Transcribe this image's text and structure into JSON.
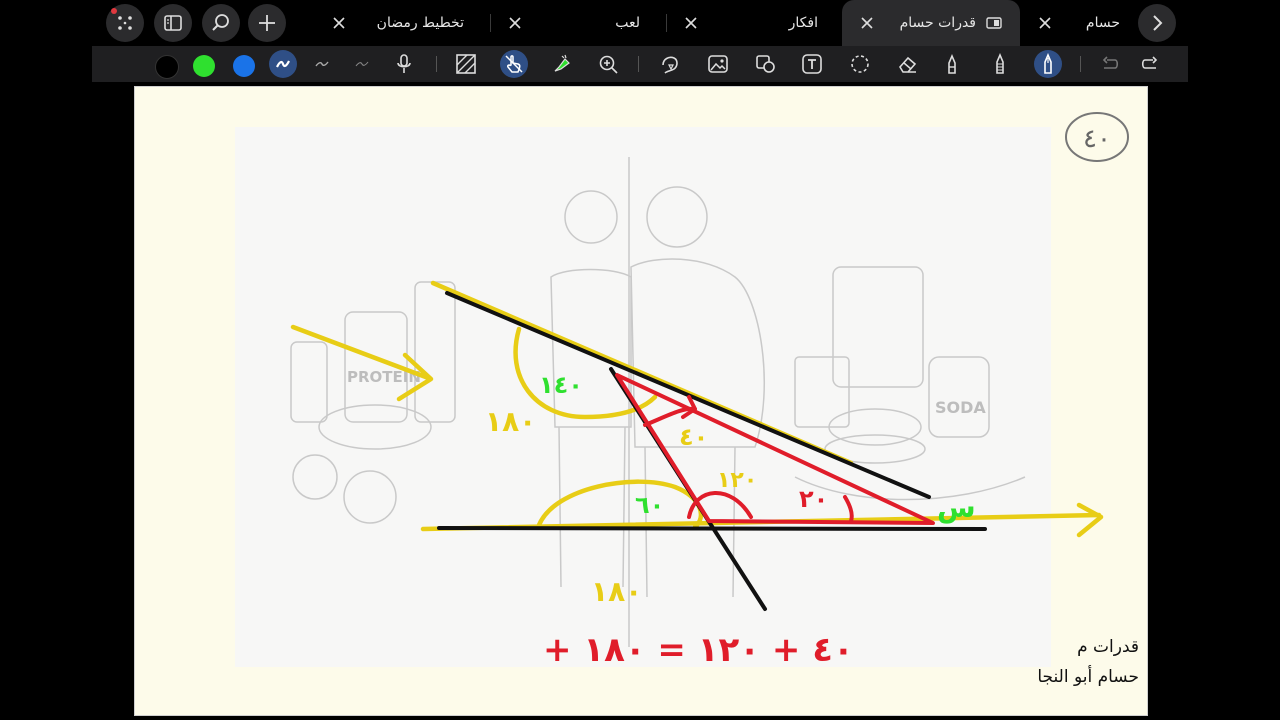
{
  "tabs": [
    {
      "label": "حسام",
      "active": false
    },
    {
      "label": "قدرات حسام",
      "active": true
    },
    {
      "label": "افكار",
      "active": false
    },
    {
      "label": "لعب",
      "active": false
    },
    {
      "label": "تخطيط رمضان",
      "active": false
    }
  ],
  "toolbar": {
    "colors": [
      "#000000",
      "#2fe02f",
      "#1a73e8"
    ]
  },
  "page": {
    "number": "٤٠",
    "footer_line1": "قدرات م",
    "footer_line2": "حسام أبو النجا"
  },
  "annotations": {
    "angle_140": "١٤٠",
    "angle_180_left": "١٨٠",
    "angle_40_top": "٤٠",
    "angle_120": "١٢٠",
    "angle_60": "٦٠",
    "angle_20": "٢٠",
    "var_s": "س",
    "angle_180_bottom": "١٨٠",
    "equation": "+ ٤٠ + ١٢٠ = ١٨٠"
  },
  "sketch_labels": {
    "protein": "PROTEIN",
    "soda": "SODA"
  }
}
